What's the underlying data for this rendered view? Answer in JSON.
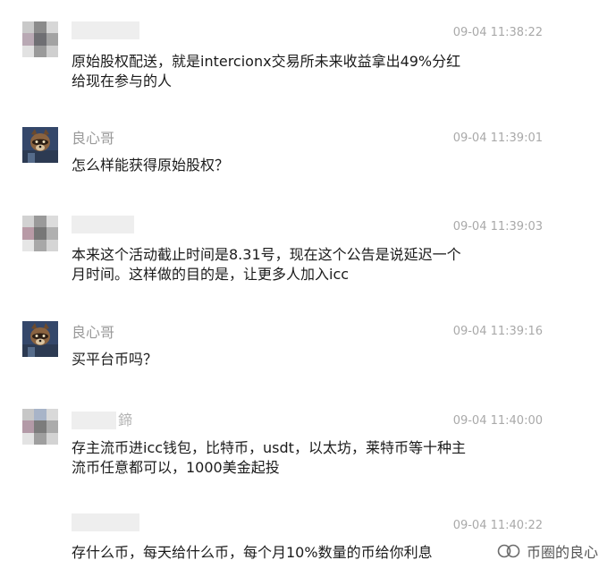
{
  "messages": [
    {
      "sender": "",
      "sender_masked": true,
      "time": "09-04 11:38:22",
      "lines": [
        "原始股权配送，就是intercionx交易所未来收益拿出49%分红",
        "给现在参与的人"
      ]
    },
    {
      "sender": "良心哥",
      "sender_masked": false,
      "time": "09-04 11:39:01",
      "lines": [
        "怎么样能获得原始股权？"
      ]
    },
    {
      "sender": "",
      "sender_masked": true,
      "time": "09-04 11:39:03",
      "lines": [
        "本来这个活动截止时间是8.31号，现在这个公告是说延迟一个",
        "月时间。这样做的目的是，让更多人加入icc"
      ]
    },
    {
      "sender": "良心哥",
      "sender_masked": false,
      "time": "09-04 11:39:16",
      "lines": [
        "买平台币吗？"
      ]
    },
    {
      "sender": "",
      "sender_masked": true,
      "sender_partial": "鍗",
      "time": "09-04 11:40:00",
      "lines": [
        "存主流币进icc钱包，比特币，usdt，以太坊，莱特币等十种主",
        "流币任意都可以，1000美金起投"
      ]
    },
    {
      "sender": "",
      "sender_masked": true,
      "time": "09-04 11:40:22",
      "lines": [
        "存什么币，每天给什么币，每个月10%数量的币给你利息"
      ]
    }
  ],
  "watermark": {
    "text": "币圈的良心",
    "icon": "wechat-official-account-icon"
  }
}
